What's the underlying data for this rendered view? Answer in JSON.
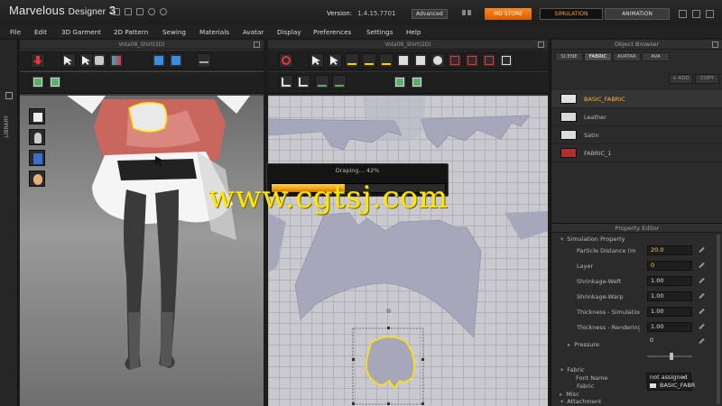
{
  "app": {
    "logo_main": "Marvelous",
    "logo_sub": "Designer",
    "logo_num": "3"
  },
  "version": {
    "label": "Version:",
    "value": "1.4.15.7701"
  },
  "edition": "Advanced",
  "header_buttons": {
    "store": "MD STORE",
    "simulation": "SIMULATION",
    "animation": "ANIMATION"
  },
  "menu": [
    "File",
    "Edit",
    "3D Garment",
    "2D Pattern",
    "Sewing",
    "Materials",
    "Avatar",
    "Display",
    "Preferences",
    "Settings",
    "Help"
  ],
  "library_label": "LIBRARY",
  "window_3d": {
    "title": "Vota08_Shirt(3D)"
  },
  "window_2d": {
    "title": "Vota08_Shirt(2D)"
  },
  "draping": {
    "label": "Draping... 42%",
    "progress": 0.42
  },
  "watermark": "www.cgtsj.com",
  "object_browser": {
    "title": "Object Browser",
    "tabs": [
      "SCENE",
      "FABRIC",
      "AVATAR",
      "AVA"
    ],
    "active_tab": 1,
    "add_label": "+ ADD",
    "copy_label": "COPY",
    "fabrics": [
      {
        "name": "BASIC_FABRIC",
        "color": "#e2e2e2",
        "selected": true
      },
      {
        "name": "Leather",
        "color": "#d8d8d8",
        "selected": false
      },
      {
        "name": "Satin",
        "color": "#dcdcdc",
        "selected": false
      },
      {
        "name": "FABRIC_1",
        "color": "#b03030",
        "selected": false
      }
    ]
  },
  "property_editor": {
    "title": "Property Editor",
    "sim_section": "Simulation Property",
    "props": [
      {
        "label": "Particle Distance (m",
        "value": "20.0",
        "highlight": true
      },
      {
        "label": "Layer",
        "value": "0",
        "highlight": true
      },
      {
        "label": "Shrinkage-Weft",
        "value": "1.00",
        "highlight": false
      },
      {
        "label": "Shrinkage-Warp",
        "value": "1.00",
        "highlight": false
      },
      {
        "label": "Thickness - Simulation",
        "value": "1.00",
        "highlight": false
      },
      {
        "label": "Thickness - Rendering",
        "value": "1.00",
        "highlight": false
      }
    ],
    "pressure": {
      "label": "Pressure",
      "value": "0",
      "level": 0.55
    },
    "fabric_section": "Fabric",
    "fabric_prop": {
      "label": "Fabric",
      "value": "BASIC_FABR"
    },
    "attachment_section": "Attachment",
    "font_prop": {
      "label": "Font Name",
      "value": "not assigned"
    },
    "misc_section": "Misc"
  },
  "colors": {
    "accent": "#ff8a1a",
    "pattern_outline": "#ffe100",
    "pattern_fill": "#a7a7bb",
    "fabric_red": "#c9665e"
  }
}
